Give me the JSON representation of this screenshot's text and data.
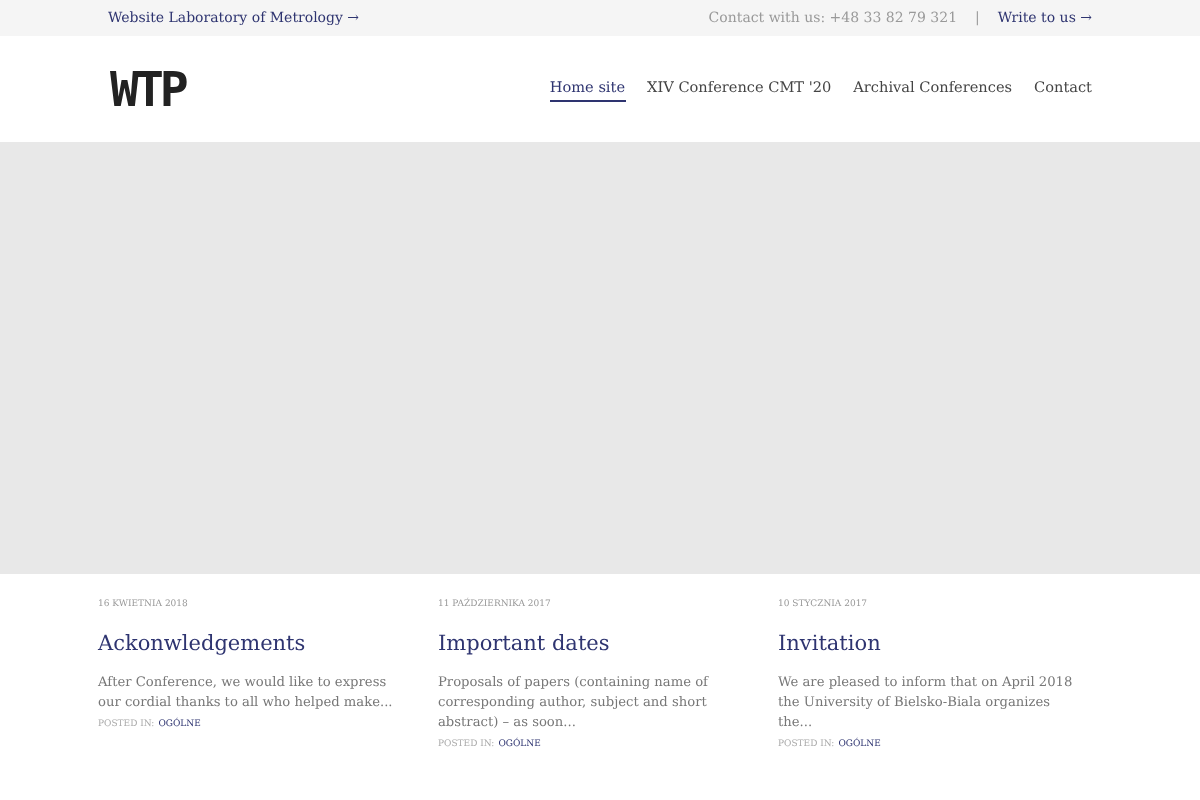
{
  "top_bar": {
    "left_link": "Website Laboratory of Metrology →",
    "contact": "Contact with us: +48 33 82 79 321",
    "separator": "|",
    "write_link": "Write to us →"
  },
  "header": {
    "logo": "WTP",
    "nav": [
      {
        "label": "Home site",
        "selected": true
      },
      {
        "label": "XIV Conference CMT '20",
        "selected": false
      },
      {
        "label": "Archival Conferences",
        "selected": false
      },
      {
        "label": "Contact",
        "selected": false
      }
    ]
  },
  "posts": [
    {
      "date": "16 KWIETNIA 2018",
      "title": "Ackonwledgements",
      "excerpt": "After Conference, we would like to express our cordial thanks to all who helped make...",
      "posted_in": "POSTED IN:",
      "category": "OGÓLNE"
    },
    {
      "date": "11 PAŹDZIERNIKA 2017",
      "title": "Important dates",
      "excerpt": "Proposals of papers (containing name of corresponding author, subject and short abstract) – as soon...",
      "posted_in": "POSTED IN:",
      "category": "OGÓLNE"
    },
    {
      "date": "10 STYCZNIA 2017",
      "title": "Invitation",
      "excerpt": "We are pleased to inform that on April 2018 the University of Bielsko-Biala organizes the...",
      "posted_in": "POSTED IN:",
      "category": "OGÓLNE"
    }
  ]
}
